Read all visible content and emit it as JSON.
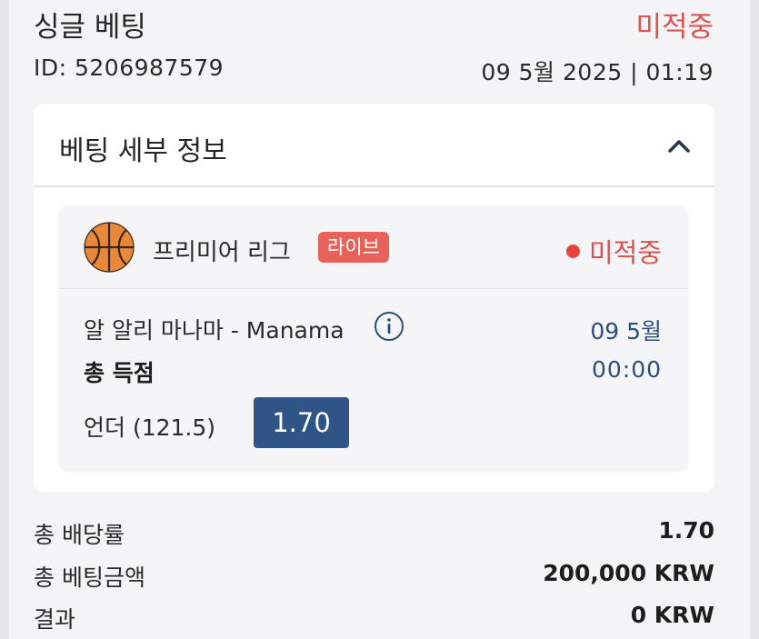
{
  "bet": {
    "type": "싱글 베팅",
    "status": "미적중",
    "id": "ID: 5206987579",
    "datetime": "09 5월 2025 | 01:19"
  },
  "details": {
    "title": "베팅 세부 정보",
    "collapse_icon": "chevron-up-icon"
  },
  "event": {
    "sport_icon": "basketball-icon",
    "league": "프리미어 리그",
    "live_badge": "라이브",
    "status": "미적중",
    "match": "알 알리 마나마 - Manama",
    "date": "09 5월",
    "market": "총 득점",
    "time": "00:00",
    "selection": "언더 (121.5)",
    "odds": "1.70"
  },
  "summary": {
    "total_odds_label": "총 배당률",
    "total_odds_value": "1.70",
    "total_stake_label": "총 베팅금액",
    "total_stake_value": "200,000 KRW",
    "result_label": "결과",
    "result_value": "0 KRW"
  },
  "colors": {
    "lost": "#d9534f",
    "live_badge": "#e8625a",
    "odds_button": "#2e5585",
    "accent_text": "#2b4e7a"
  }
}
